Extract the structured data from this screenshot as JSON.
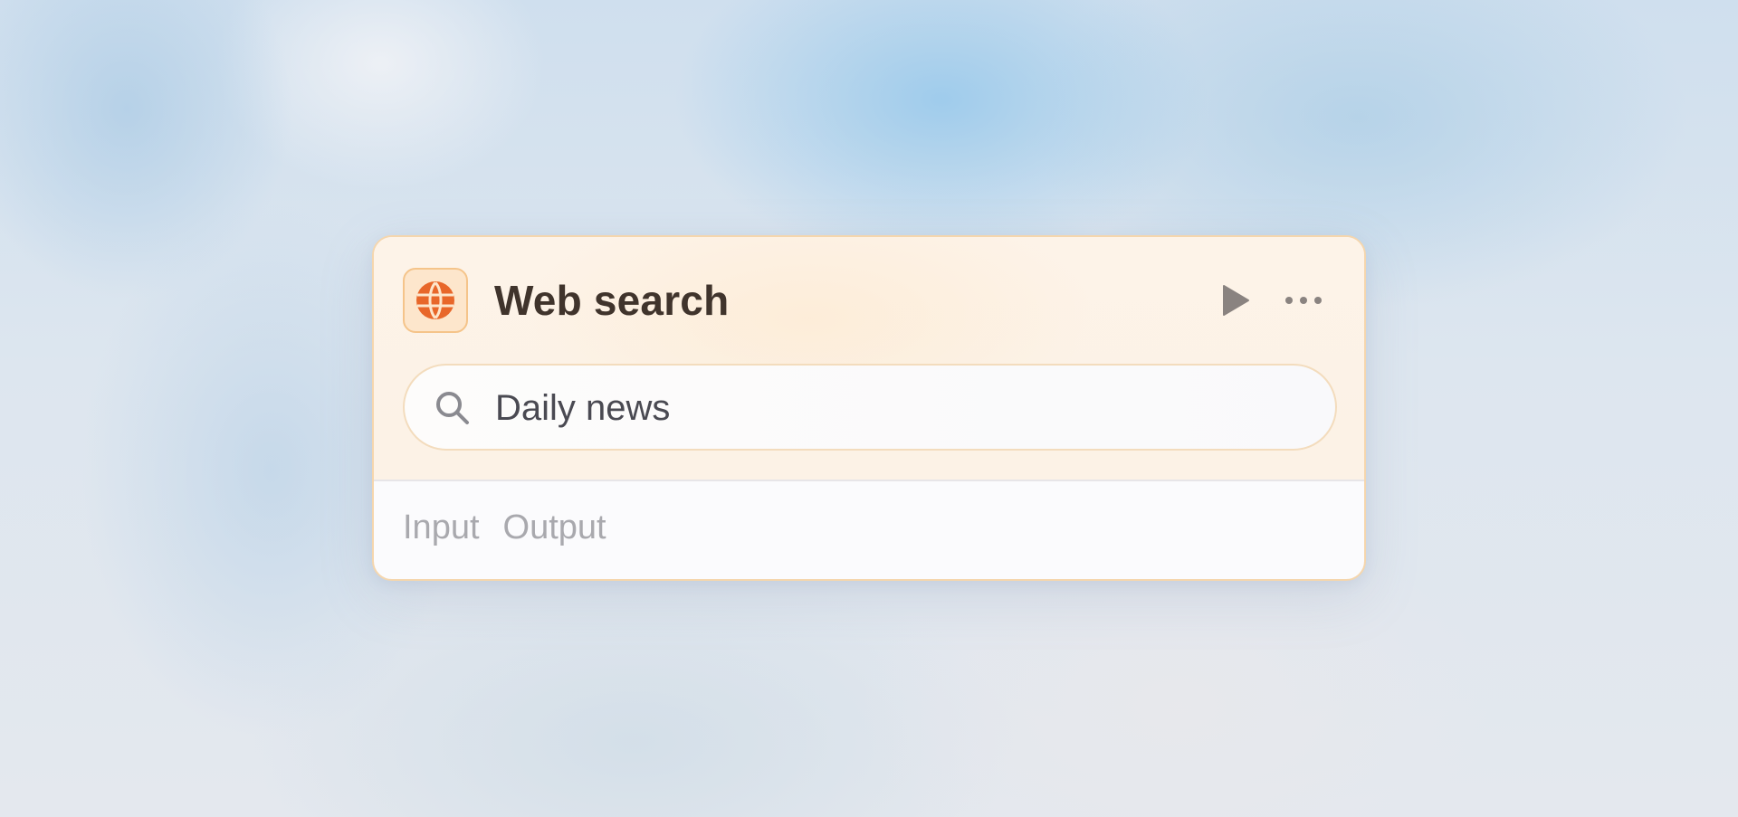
{
  "node": {
    "icon": "globe-icon",
    "title": "Web search",
    "actions": {
      "run_icon": "play-icon",
      "more_icon": "more-horizontal-icon"
    },
    "search": {
      "icon": "search-icon",
      "value": "Daily news"
    },
    "tabs": [
      {
        "label": "Input"
      },
      {
        "label": "Output"
      }
    ]
  },
  "colors": {
    "accent": "#e8672a",
    "icon_bg": "#fde6cc",
    "border": "#f5d6ad",
    "title": "#40342c",
    "tab_text": "#a9a9ae"
  }
}
